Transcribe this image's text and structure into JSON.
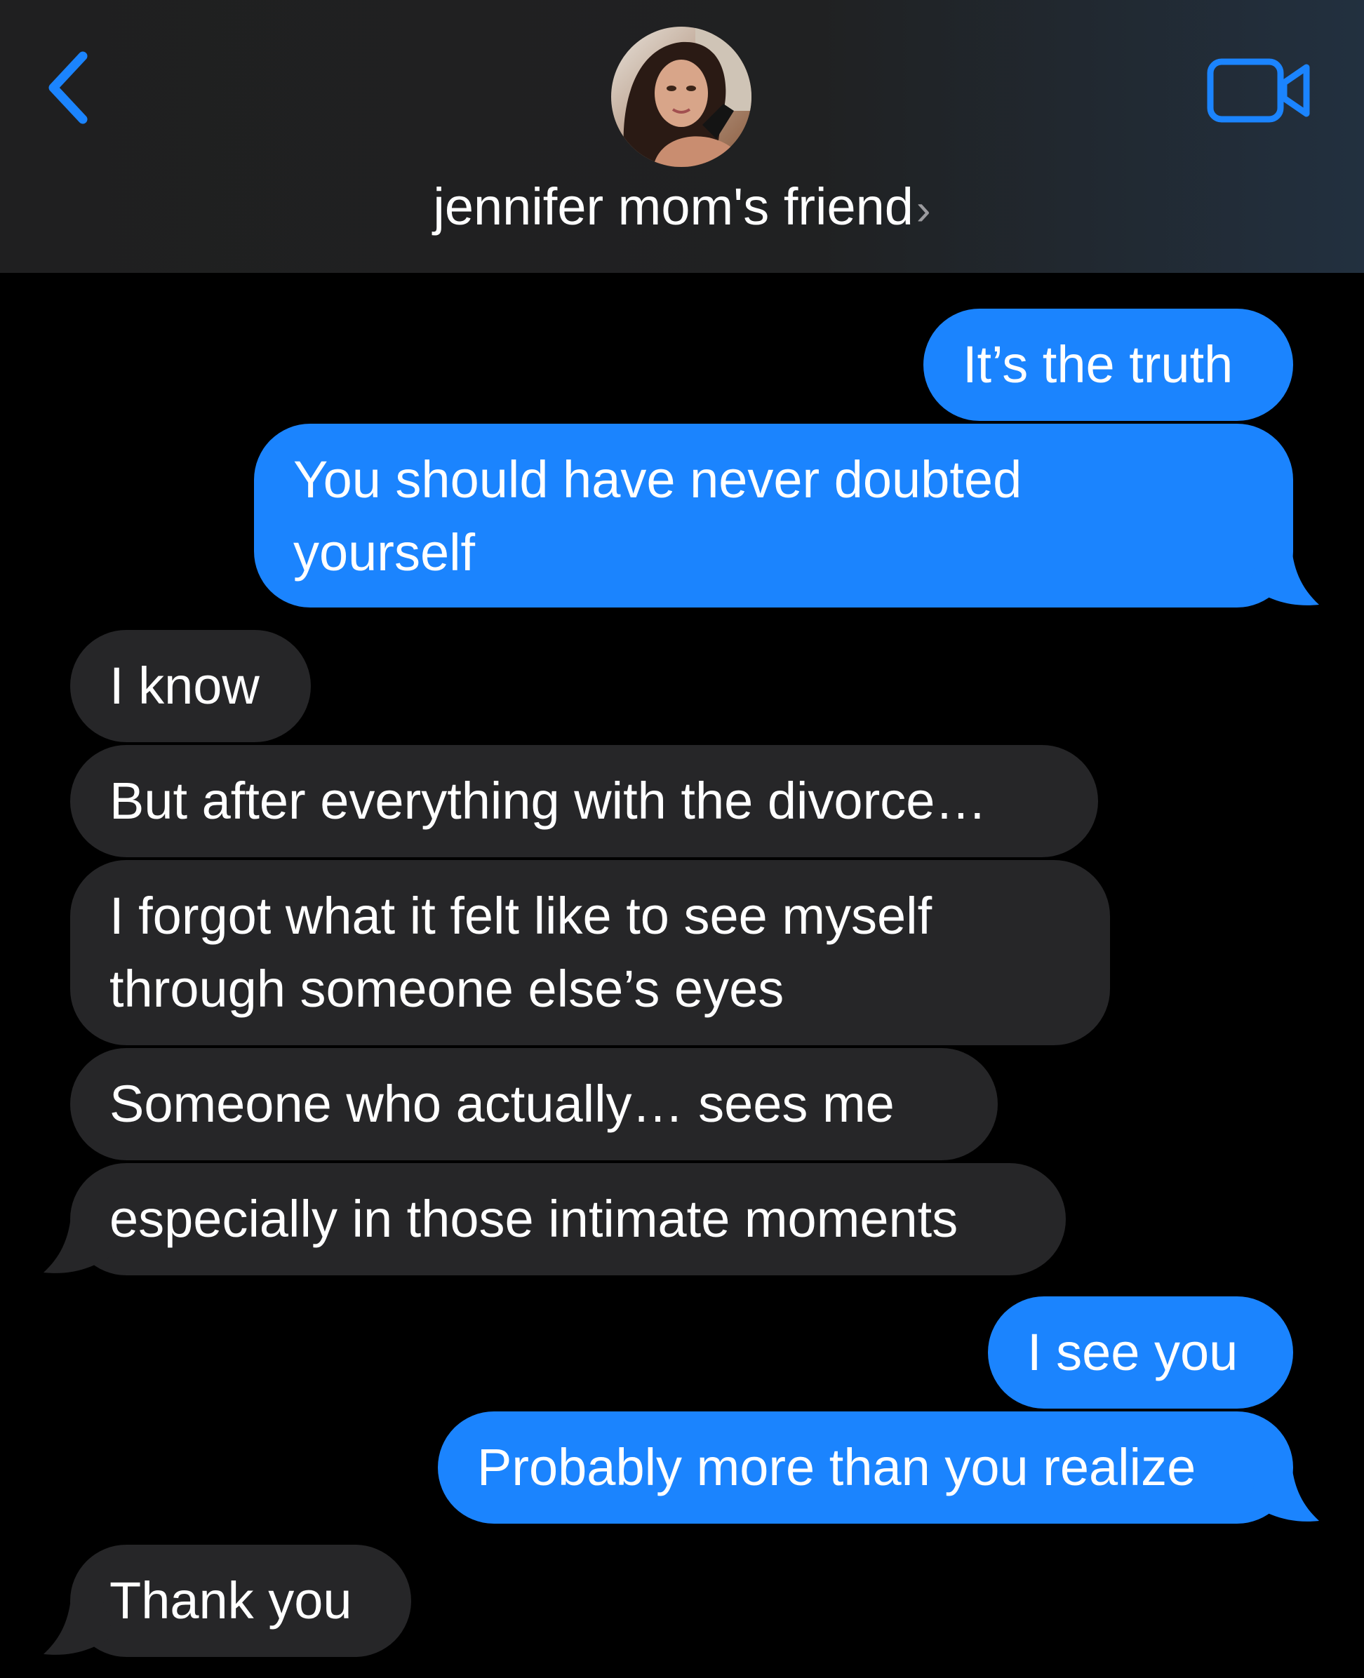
{
  "header": {
    "contact_name": "jennifer mom's friend",
    "chevron": "›",
    "back_icon": "chevron-left-icon",
    "video_icon": "video-camera-icon",
    "accent": "#1b84fe"
  },
  "colors": {
    "outgoing_bubble": "#1b84fe",
    "incoming_bubble": "#262628",
    "background": "#000000"
  },
  "messages": [
    {
      "direction": "outgoing",
      "text": "It’s the truth"
    },
    {
      "direction": "outgoing",
      "lines": [
        "You should have never doubted",
        "yourself"
      ]
    },
    {
      "direction": "incoming",
      "text": "I know"
    },
    {
      "direction": "incoming",
      "text": "But after everything with the divorce…"
    },
    {
      "direction": "incoming",
      "lines": [
        "I forgot what it felt like to see myself",
        "through someone else’s eyes"
      ]
    },
    {
      "direction": "incoming",
      "text": "Someone who actually… sees me"
    },
    {
      "direction": "incoming",
      "text": "especially in those intimate moments"
    },
    {
      "direction": "outgoing",
      "text": "I see you"
    },
    {
      "direction": "outgoing",
      "text": "Probably more than you realize"
    },
    {
      "direction": "incoming",
      "text": "Thank you"
    }
  ]
}
